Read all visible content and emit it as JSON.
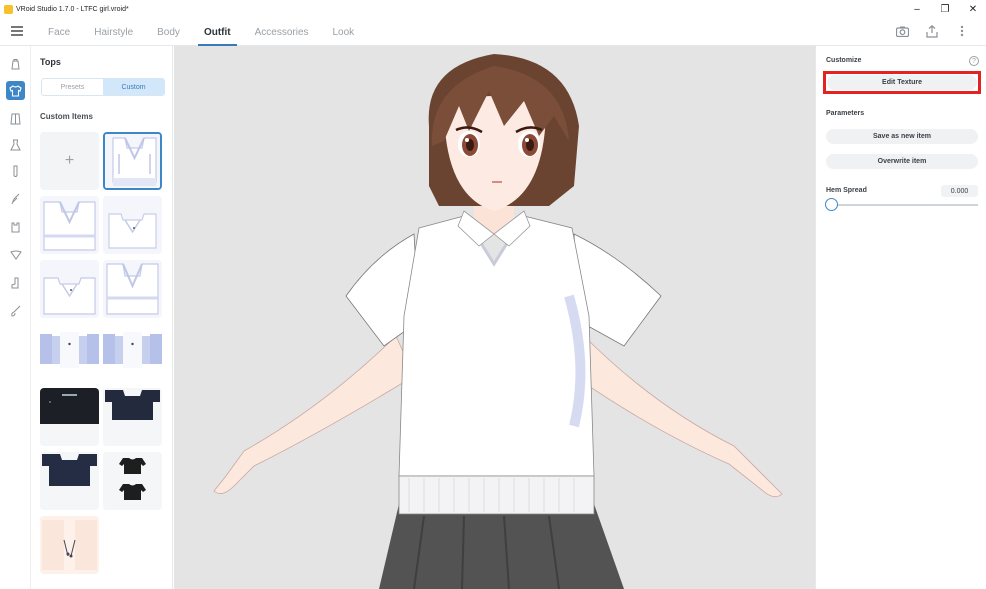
{
  "window": {
    "title": "VRoid Studio 1.7.0 - LTFC girl.vroid*",
    "controls": [
      "–",
      "❐",
      "✕"
    ]
  },
  "topnav": {
    "tabs": [
      {
        "label": "Face"
      },
      {
        "label": "Hairstyle"
      },
      {
        "label": "Body"
      },
      {
        "label": "Outfit"
      },
      {
        "label": "Accessories"
      },
      {
        "label": "Look"
      }
    ],
    "active_tab": "Outfit",
    "icons": [
      "camera-icon",
      "export-icon",
      "more-vertical-icon"
    ]
  },
  "rail": {
    "icons": [
      "hat-icon",
      "tops-icon",
      "jacket-icon",
      "dress-icon",
      "sock-icon",
      "glove-icon",
      "shoes-icon",
      "neck-icon",
      "boot-icon",
      "brush-icon"
    ],
    "active_index": 1
  },
  "left_panel": {
    "title": "Tops",
    "segments": [
      "Presets",
      "Custom"
    ],
    "active_segment": "Custom",
    "section_label": "Custom Items",
    "add_symbol": "+",
    "items": [
      "add-item",
      "white-vest-texture",
      "white-vest-texture-2",
      "white-vest-texture-3",
      "white-vest-texture-4",
      "white-vest-texture-5",
      "blue-shirt-texture",
      "blue-shirt-texture-2",
      "black-jacket-texture",
      "navy-jacket-texture",
      "navy-shirt-texture",
      "black-tshirt-texture",
      "skin-texture"
    ],
    "selected_index": 1
  },
  "right_panel": {
    "customize_label": "Customize",
    "help_symbol": "?",
    "edit_texture_label": "Edit Texture",
    "parameters_label": "Parameters",
    "save_new_label": "Save as new item",
    "overwrite_label": "Overwrite item",
    "hem_spread_label": "Hem Spread",
    "hem_spread_value": "0.000",
    "hem_spread_slider": 0
  },
  "colors": {
    "accent": "#3d87c7",
    "highlight_box": "#e32222",
    "viewport_bg": "#e4e4e4"
  }
}
